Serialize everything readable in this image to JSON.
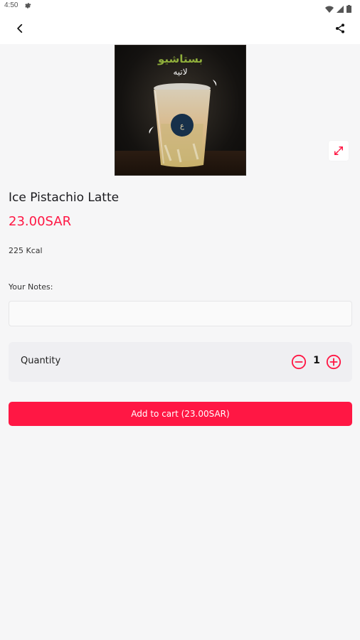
{
  "status_bar": {
    "time": "4:50",
    "icons": [
      "settings-icon",
      "wifi-icon",
      "signal-icon",
      "battery-icon"
    ]
  },
  "app_bar": {
    "back_icon": "chevron-left-icon",
    "share_icon": "share-icon"
  },
  "product": {
    "image_text_line1": "بستاشيو",
    "image_text_line2": "لاتيه",
    "name": "Ice Pistachio Latte",
    "price": "23.00SAR",
    "calories": "225 Kcal",
    "expand_icon": "expand-icon"
  },
  "notes": {
    "label": "Your Notes:",
    "value": "",
    "placeholder": ""
  },
  "quantity": {
    "label": "Quantity",
    "value": "1",
    "minus_icon": "minus-circle-icon",
    "plus_icon": "plus-circle-icon"
  },
  "cart": {
    "button_label": "Add to cart (23.00SAR)"
  },
  "colors": {
    "accent": "#ff1744",
    "background": "#f6f6f7",
    "card": "#efeff2"
  }
}
